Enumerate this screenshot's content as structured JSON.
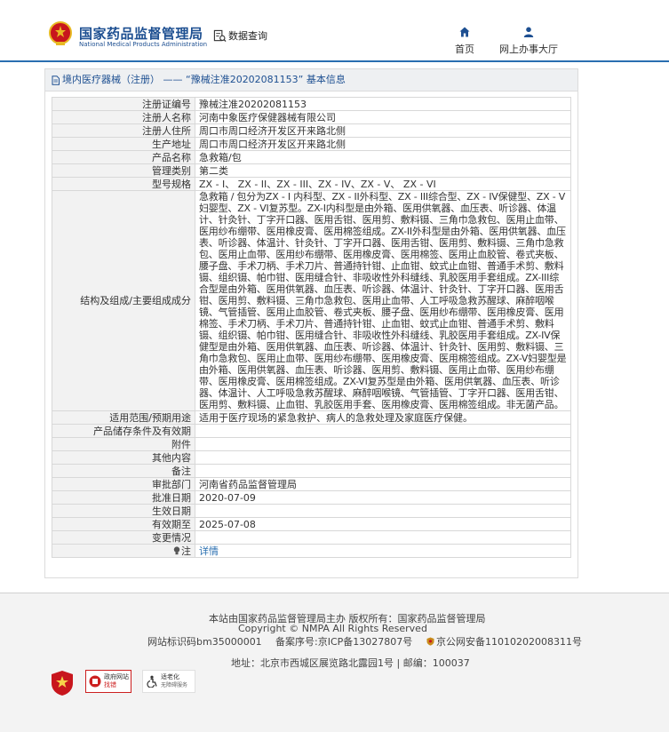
{
  "header": {
    "logo_cn": "国家药品监督管理局",
    "logo_en": "National Medical Products Administration",
    "nav_query": "数据查询",
    "nav_home": "首页",
    "nav_office": "网上办事大厅"
  },
  "panel": {
    "title": "境内医疗器械（注册） —— “豫械注准20202081153” 基本信息"
  },
  "rows": [
    {
      "label": "注册证编号",
      "value": "豫械注准20202081153"
    },
    {
      "label": "注册人名称",
      "value": "河南中象医疗保健器械有限公司"
    },
    {
      "label": "注册人住所",
      "value": "周口市周口经济开发区开来路北侧"
    },
    {
      "label": "生产地址",
      "value": "周口市周口经济开发区开来路北侧"
    },
    {
      "label": "产品名称",
      "value": "急救箱/包"
    },
    {
      "label": "管理类别",
      "value": "第二类"
    },
    {
      "label": "型号规格",
      "value": "ZX - I、 ZX - II、ZX - III、ZX - IV、ZX - V、 ZX - VI"
    },
    {
      "label": "结构及组成/主要组成成分",
      "value": "急救箱 / 包分为ZX - I 内科型、ZX - II外科型、ZX - III综合型、ZX - IV保健型、ZX - V妇婴型、ZX - VI复苏型。ZX-I内科型是由外箱、医用供氧器、血压表、听诊器、体温计、针灸针、丁字开口器、医用舌钳、医用剪、敷料镊、三角巾急救包、医用止血带、医用纱布绷带、医用橡皮膏、医用棉签组成。ZX-II外科型是由外箱、医用供氧器、血压表、听诊器、体温计、针灸针、丁字开口器、医用舌钳、医用剪、敷料镊、三角巾急救包、医用止血带、医用纱布绷带、医用橡皮膏、医用棉签、医用止血胶管、卷式夹板、腰子盘、手术刀柄、手术刀片、普通持针钳、止血钳、蚊式止血钳、普通手术剪、敷料镊、组织镊、帕巾钳、医用缝合针、非吸收性外科缝线、乳胶医用手套组成。ZX-III综合型是由外箱、医用供氧器、血压表、听诊器、体温计、针灸针、丁字开口器、医用舌钳、医用剪、敷料镊、三角巾急救包、医用止血带、人工呼吸急救苏醒球、麻醉咽喉镜、气管插管、医用止血胶管、卷式夹板、腰子盘、医用纱布绷带、医用橡皮膏、医用棉签、手术刀柄、手术刀片、普通持针钳、止血钳、蚊式止血钳、普通手术剪、敷料镊、组织镊、帕巾钳、医用缝合针、非吸收性外科缝线、乳胶医用手套组成。ZX-IV保健型是由外箱、医用供氧器、血压表、听诊器、体温计、针灸针、医用剪、敷料镊、三角巾急救包、医用止血带、医用纱布绷带、医用橡皮膏、医用棉签组成。ZX-V妇婴型是由外箱、医用供氧器、血压表、听诊器、医用剪、敷料镊、医用止血带、医用纱布绷带、医用橡皮膏、医用棉签组成。ZX-VI复苏型是由外箱、医用供氧器、血压表、听诊器、体温计、人工呼吸急救苏醒球、麻醉咽喉镜、气管插管、丁字开口器、医用舌钳、医用剪、敷料镊、止血钳、乳胶医用手套、医用橡皮膏、医用棉签组成。非无菌产品。"
    },
    {
      "label": "适用范围/预期用途",
      "value": "适用于医疗现场的紧急救护、病人的急救处理及家庭医疗保健。"
    },
    {
      "label": "产品储存条件及有效期",
      "value": ""
    },
    {
      "label": "附件",
      "value": ""
    },
    {
      "label": "其他内容",
      "value": ""
    },
    {
      "label": "备注",
      "value": ""
    },
    {
      "label": "审批部门",
      "value": "河南省药品监督管理局"
    },
    {
      "label": "批准日期",
      "value": "2020-07-09"
    },
    {
      "label": "生效日期",
      "value": ""
    },
    {
      "label": "有效期至",
      "value": "2025-07-08"
    },
    {
      "label": "变更情况",
      "value": ""
    },
    {
      "label": "注",
      "value": "详情"
    }
  ],
  "footer": {
    "line1": "本站由国家药品监督管理局主办 版权所有：国家药品监督管理局",
    "line2": "Copyright © NMPA All Rights Reserved",
    "line3a": "网站标识码bm35000001",
    "line3b": "备案序号:京ICP备13027807号",
    "line3c": "京公网安备11010202008311号",
    "line4": "地址：北京市西城区展览路北露园1号 | 邮编：100037",
    "badge2_line1": "政府网站",
    "badge2_line2": "找错",
    "badge3_line1": "适老化",
    "badge3_line2": "无障碍服务"
  },
  "colors": {
    "brand": "#1d4f91",
    "accent_line": "#2a6fb0",
    "label_bg": "#f2f2f2",
    "emblem_red": "#c8161d",
    "emblem_gold": "#e8b923"
  },
  "icons": [
    "emblem-icon",
    "data-query-icon",
    "home-icon",
    "user-icon",
    "document-icon",
    "note-bulb-icon",
    "police-badge-icon"
  ]
}
